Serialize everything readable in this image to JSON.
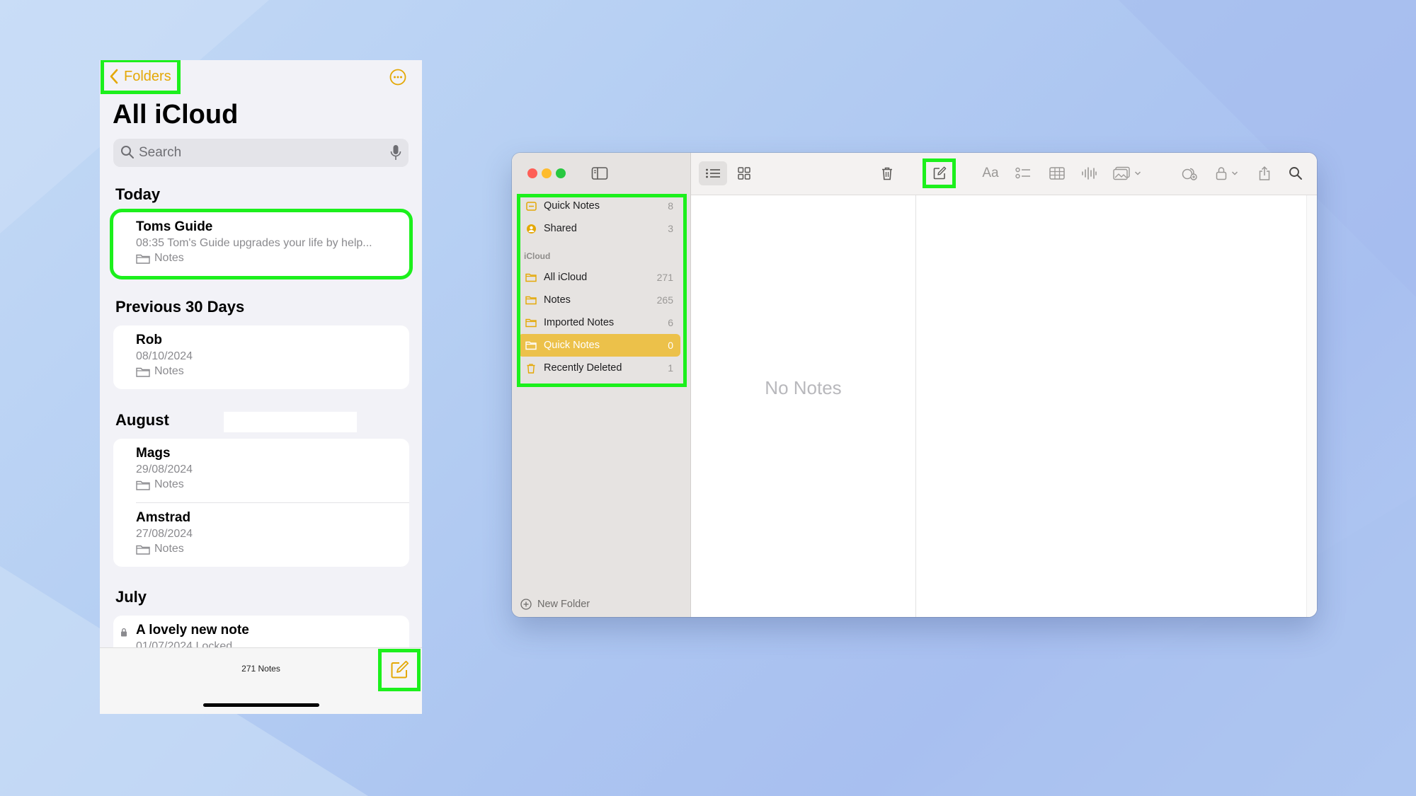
{
  "phone": {
    "back_label": "Folders",
    "title": "All iCloud",
    "search_placeholder": "Search",
    "sections": {
      "today": "Today",
      "previous": "Previous 30 Days",
      "august": "August",
      "july": "July"
    },
    "notes": [
      {
        "title": "Toms Guide",
        "meta": "08:35  Tom's Guide upgrades your life by help...",
        "folder": "Notes"
      },
      {
        "title": "Rob",
        "meta": "08/10/2024",
        "folder": "Notes"
      },
      {
        "title": "Mags",
        "meta": "29/08/2024",
        "folder": "Notes"
      },
      {
        "title": "Amstrad",
        "meta": "27/08/2024",
        "folder": "Notes"
      },
      {
        "title": "A lovely new note",
        "meta": "01/07/2024  Locked"
      }
    ],
    "note_count": "271 Notes"
  },
  "mac": {
    "sidebar": {
      "items": [
        {
          "label": "Quick Notes",
          "count": "8",
          "icon": "quick-notes-icon"
        },
        {
          "label": "Shared",
          "count": "3",
          "icon": "shared-icon"
        }
      ],
      "group_label": "iCloud",
      "folders": [
        {
          "label": "All iCloud",
          "count": "271"
        },
        {
          "label": "Notes",
          "count": "265"
        },
        {
          "label": "Imported Notes",
          "count": "6"
        },
        {
          "label": "Quick Notes",
          "count": "0",
          "selected": true
        },
        {
          "label": "Recently Deleted",
          "count": "1"
        }
      ],
      "new_folder_label": "New Folder"
    },
    "empty_label": "No Notes",
    "format_label": "Aa"
  },
  "colors": {
    "accent_yellow": "#e4a806",
    "selection": "#ecc14a",
    "highlight_green": "#1cf01c"
  }
}
